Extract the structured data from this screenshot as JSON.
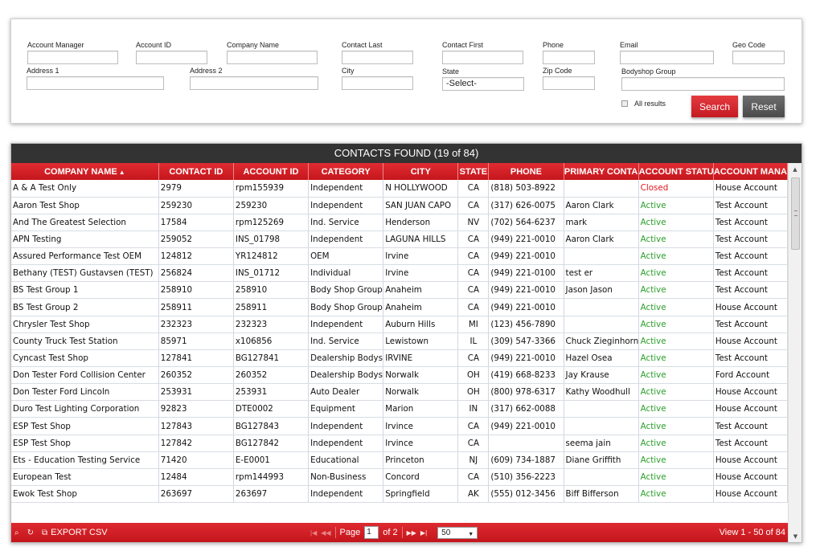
{
  "search": {
    "fields": {
      "account_manager": {
        "label": "Account Manager",
        "value": ""
      },
      "account_id": {
        "label": "Account ID",
        "value": ""
      },
      "company_name": {
        "label": "Company Name",
        "value": ""
      },
      "contact_last": {
        "label": "Contact Last",
        "value": ""
      },
      "contact_first": {
        "label": "Contact First",
        "value": ""
      },
      "phone": {
        "label": "Phone",
        "value": ""
      },
      "email": {
        "label": "Email",
        "value": ""
      },
      "geo_code": {
        "label": "Geo Code",
        "value": ""
      },
      "address1": {
        "label": "Address 1",
        "value": ""
      },
      "address2": {
        "label": "Address 2",
        "value": ""
      },
      "city": {
        "label": "City",
        "value": ""
      },
      "state": {
        "label": "State",
        "value": "-Select-"
      },
      "zip": {
        "label": "Zip Code",
        "value": ""
      },
      "bodyshop_group": {
        "label": "Bodyshop Group",
        "value": ""
      }
    },
    "all_results_label": "All results",
    "search_label": "Search",
    "reset_label": "Reset"
  },
  "grid": {
    "title": "CONTACTS FOUND (19 of 84)",
    "columns": [
      "COMPANY NAME",
      "CONTACT ID",
      "ACCOUNT ID",
      "CATEGORY",
      "CITY",
      "STATE",
      "PHONE",
      "PRIMARY CONTA",
      "ACCOUNT STATU",
      "ACCOUNT MANA"
    ],
    "sort_indicator": "▲",
    "rows": [
      [
        "A & A Test Only",
        "2979",
        "rpm155939",
        "Independent",
        "N HOLLYWOOD",
        "CA",
        "(818) 503-8922",
        "",
        "Closed",
        "House Account"
      ],
      [
        "Aaron Test Shop",
        "259230",
        "259230",
        "Independent",
        "SAN JUAN CAPO",
        "CA",
        "(317) 626-0075",
        "Aaron Clark",
        "Active",
        "Test Account"
      ],
      [
        "And The Greatest Selection",
        "17584",
        "rpm125269",
        "Ind. Service",
        "Henderson",
        "NV",
        "(702) 564-6237",
        "mark",
        "Active",
        "Test Account"
      ],
      [
        "APN Testing",
        "259052",
        "INS_01798",
        "Independent",
        "LAGUNA HILLS",
        "CA",
        "(949) 221-0010",
        "Aaron Clark",
        "Active",
        "Test Account"
      ],
      [
        "Assured Performance Test OEM",
        "124812",
        "YR124812",
        "OEM",
        "Irvine",
        "CA",
        "(949) 221-0010",
        "",
        "Active",
        "Test Account"
      ],
      [
        "Bethany (TEST) Gustavsen (TEST)",
        "256824",
        "INS_01712",
        "Individual",
        "Irvine",
        "CA",
        "(949) 221-0100",
        "test er",
        "Active",
        "Test Account"
      ],
      [
        "BS Test Group 1",
        "258910",
        "258910",
        "Body Shop Group",
        "Anaheim",
        "CA",
        "(949) 221-0010",
        "Jason Jason",
        "Active",
        "Test Account"
      ],
      [
        "BS Test Group 2",
        "258911",
        "258911",
        "Body Shop Group",
        "Anaheim",
        "CA",
        "(949) 221-0010",
        "",
        "Active",
        "House Account"
      ],
      [
        "Chrysler Test Shop",
        "232323",
        "232323",
        "Independent",
        "Auburn Hills",
        "MI",
        "(123) 456-7890",
        "",
        "Active",
        "Test Account"
      ],
      [
        "County Truck Test Station",
        "85971",
        "x106856",
        "Ind. Service",
        "Lewistown",
        "IL",
        "(309) 547-3366",
        "Chuck Zieginhorn",
        "Active",
        "House Account"
      ],
      [
        "Cyncast Test Shop",
        "127841",
        "BG127841",
        "Dealership Bodysh",
        "IRVINE",
        "CA",
        "(949) 221-0010",
        "Hazel Osea",
        "Active",
        "Test Account"
      ],
      [
        "Don Tester Ford Collision Center",
        "260352",
        "260352",
        "Dealership Bodysh",
        "Norwalk",
        "OH",
        "(419) 668-8233",
        "Jay Krause",
        "Active",
        "Ford Account"
      ],
      [
        "Don Tester Ford Lincoln",
        "253931",
        "253931",
        "Auto Dealer",
        "Norwalk",
        "OH",
        "(800) 978-6317",
        "Kathy Woodhull",
        "Active",
        "House Account"
      ],
      [
        "Duro Test Lighting Corporation",
        "92823",
        "DTE0002",
        "Equipment",
        "Marion",
        "IN",
        "(317) 662-0088",
        "",
        "Active",
        "House Account"
      ],
      [
        "ESP Test Shop",
        "127843",
        "BG127843",
        "Independent",
        "Irvince",
        "CA",
        "(949) 221-0010",
        "",
        "Active",
        "Test Account"
      ],
      [
        "ESP Test Shop",
        "127842",
        "BG127842",
        "Independent",
        "Irvince",
        "CA",
        "",
        "seema jain",
        "Active",
        "Test Account"
      ],
      [
        "Ets - Education Testing Service",
        "71420",
        "E-E0001",
        "Educational",
        "Princeton",
        "NJ",
        "(609) 734-1887",
        "Diane Griffith",
        "Active",
        "House Account"
      ],
      [
        "European Test",
        "12484",
        "rpm144993",
        "Non-Business",
        "Concord",
        "CA",
        "(510) 356-2223",
        "",
        "Active",
        "House Account"
      ],
      [
        "Ewok Test Shop",
        "263697",
        "263697",
        "Independent",
        "Springfield",
        "AK",
        "(555) 012-3456",
        "Biff Bifferson",
        "Active",
        "House Account"
      ]
    ]
  },
  "pager": {
    "export_label": "EXPORT CSV",
    "page_label": "Page",
    "page_value": "1",
    "of_label": "of 2",
    "page_size": "50",
    "view_label": "View 1 - 50 of 84"
  },
  "colors": {
    "accent_red": "#c8171e",
    "header_dark": "#333333",
    "active_green": "#2aa02a",
    "closed_red": "#e0191f"
  }
}
